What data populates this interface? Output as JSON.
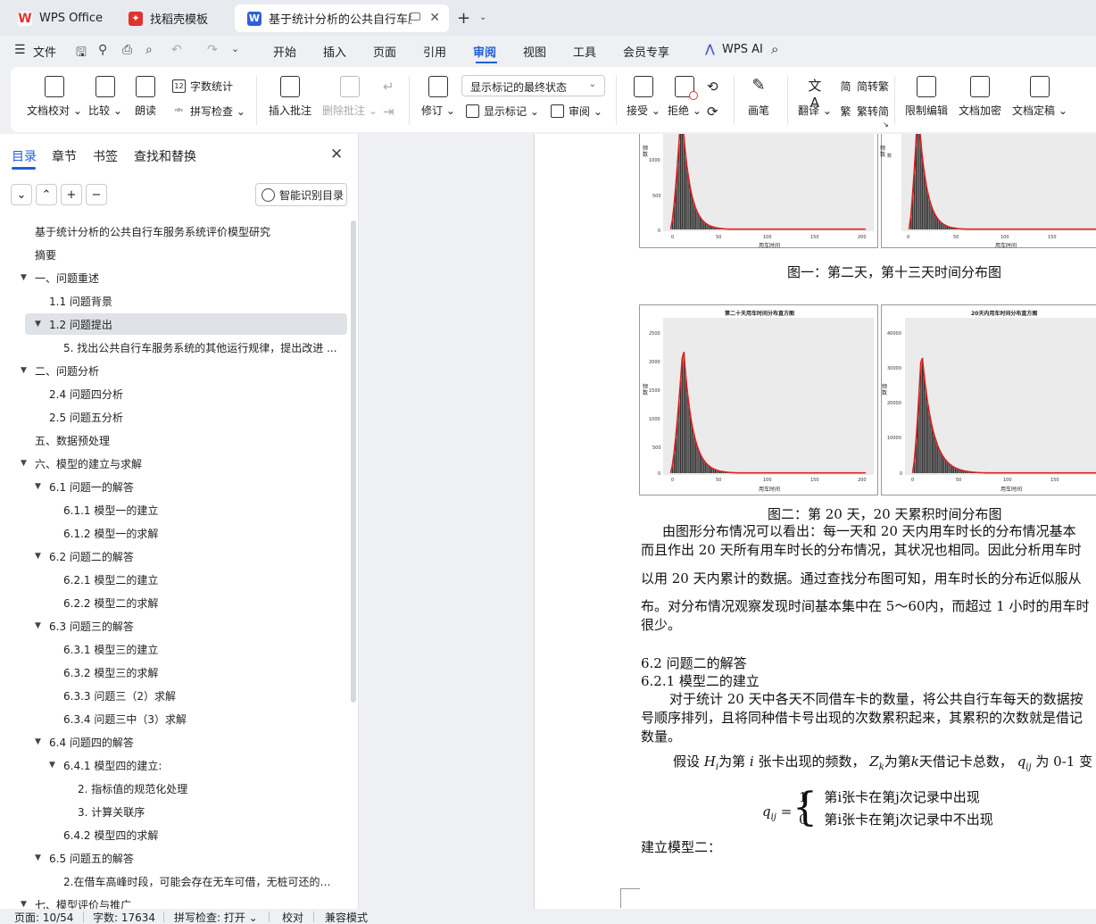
{
  "tabs": [
    {
      "label": "WPS Office",
      "icon": "wps-logo-icon"
    },
    {
      "label": "找稻壳模板",
      "icon": "docer-logo-icon"
    },
    {
      "label": "基于统计分析的公共自行车服务",
      "icon": "word-doc-icon"
    }
  ],
  "menu": {
    "file": "文件",
    "items": [
      "开始",
      "插入",
      "页面",
      "引用",
      "审阅",
      "视图",
      "工具",
      "会员专享"
    ],
    "active": "审阅",
    "wps_ai": "WPS AI"
  },
  "ribbon": {
    "doc_proof": "文档校对",
    "compare": "比较",
    "read_aloud": "朗读",
    "word_count": "字数统计",
    "spell_check": "拼写检查",
    "insert_comment": "插入批注",
    "delete_comment": "删除批注",
    "revise": "修订",
    "markup_state": "显示标记的最终状态",
    "show_markup": "显示标记",
    "review_pane": "审阅",
    "accept": "接受",
    "reject": "拒绝",
    "pen": "画笔",
    "translate": "翻译",
    "simp_to_trad": "简转繁",
    "trad_to_simp": "繁转简",
    "restrict_edit": "限制编辑",
    "doc_encrypt": "文档加密",
    "doc_finalize": "文档定稿"
  },
  "sidebar": {
    "tabs": [
      "目录",
      "章节",
      "书签",
      "查找和替换"
    ],
    "smart_toc": "智能识别目录",
    "toc": [
      {
        "text": "基于统计分析的公共自行车服务系统评价模型研究",
        "level": 0,
        "arrow": false
      },
      {
        "text": "摘要",
        "level": 0,
        "arrow": false
      },
      {
        "text": "一、问题重述",
        "level": 0,
        "arrow": true
      },
      {
        "text": "1.1 问题背景",
        "level": 1,
        "arrow": false
      },
      {
        "text": "1.2 问题提出",
        "level": 1,
        "arrow": true,
        "selected": true
      },
      {
        "text": "5. 找出公共自行车服务系统的其他运行规律，提出改进 ...",
        "level": 2,
        "arrow": false
      },
      {
        "text": "二、问题分析",
        "level": 0,
        "arrow": true
      },
      {
        "text": "2.4 问题四分析",
        "level": 1,
        "arrow": false
      },
      {
        "text": "2.5 问题五分析",
        "level": 1,
        "arrow": false
      },
      {
        "text": "五、数据预处理",
        "level": 0,
        "arrow": false
      },
      {
        "text": "六、模型的建立与求解",
        "level": 0,
        "arrow": true
      },
      {
        "text": "6.1 问题一的解答",
        "level": 1,
        "arrow": true
      },
      {
        "text": "6.1.1 模型一的建立",
        "level": 2,
        "arrow": false
      },
      {
        "text": "6.1.2 模型一的求解",
        "level": 2,
        "arrow": false
      },
      {
        "text": "6.2 问题二的解答",
        "level": 1,
        "arrow": true
      },
      {
        "text": "6.2.1 模型二的建立",
        "level": 2,
        "arrow": false
      },
      {
        "text": "6.2.2 模型二的求解",
        "level": 2,
        "arrow": false
      },
      {
        "text": "6.3 问题三的解答",
        "level": 1,
        "arrow": true
      },
      {
        "text": "6.3.1 模型三的建立",
        "level": 2,
        "arrow": false
      },
      {
        "text": "6.3.2 模型三的求解",
        "level": 2,
        "arrow": false
      },
      {
        "text": "6.3.3  问题三（2）求解",
        "level": 2,
        "arrow": false
      },
      {
        "text": "6.3.4  问题三中（3）求解",
        "level": 2,
        "arrow": false
      },
      {
        "text": "6.4 问题四的解答",
        "level": 1,
        "arrow": true
      },
      {
        "text": "6.4.1 模型四的建立:",
        "level": 2,
        "arrow": true
      },
      {
        "text": "2. 指标值的规范化处理",
        "level": 3,
        "arrow": false
      },
      {
        "text": "3. 计算关联序",
        "level": 3,
        "arrow": false
      },
      {
        "text": "6.4.2 模型四的求解",
        "level": 2,
        "arrow": false
      },
      {
        "text": "6.5 问题五的解答",
        "level": 1,
        "arrow": true
      },
      {
        "text": "2.在借车高峰时段，可能会存在无车可借，无桩可还的情...",
        "level": 2,
        "arrow": false
      },
      {
        "text": "七、模型评价与推广",
        "level": 0,
        "arrow": true
      }
    ]
  },
  "document": {
    "fig1_caption": "图一：第二天，第十三天时间分布图",
    "fig2_caption": "图二：第 20 天，20 天累积时间分布图",
    "fig_top": {
      "ylabel": "频数",
      "xlabel": "用车时间",
      "yticks_left": [
        "1000",
        "500",
        "0"
      ],
      "yticks_right": [
        "数"
      ],
      "xticks_left": [
        "0",
        "50",
        "100",
        "150",
        "200"
      ],
      "xticks_right": [
        "0",
        "50",
        "100",
        "150"
      ]
    },
    "fig_bottom_left": {
      "title": "第二十天用车时间分布直方图",
      "ylabel": "频数",
      "xlabel": "用车时间",
      "yticks": [
        "2500",
        "2000",
        "1500",
        "1000",
        "500",
        "0"
      ],
      "xticks": [
        "0",
        "50",
        "100",
        "150",
        "200"
      ]
    },
    "fig_bottom_right": {
      "title": "20天内用车时间分布直方图",
      "ylabel": "频数",
      "xlabel": "用车时间",
      "yticks": [
        "40000",
        "30000",
        "20000",
        "10000",
        "0"
      ],
      "xticks": [
        "0",
        "50",
        "100",
        "150"
      ]
    },
    "para1": [
      "由图形分布情况可以看出：每一天和 20 天内用车时长的分布情况基本",
      "而且作出 20 天所有用车时长的分布情况，其状况也相同。因此分析用车时",
      "以用 20 天内累计的数据。通过查找分布图可知，用车时长的分布近似服从",
      "布。对分布情况观察发现时间基本集中在 5～60内，而超过 1 小时的用车时",
      "很少。"
    ],
    "h_6_2": "6.2 问题二的解答",
    "h_6_2_1": "6.2.1 模型二的建立",
    "para2": [
      "对于统计 20 天中各天不同借车卡的数量，将公共自行车每天的数据按",
      "号顺序排列，且将同种借卡号出现的次数累积起来，其累积的次数就是借记",
      "数量。"
    ],
    "assume": "假设 H_i为第 i 张卡出现的频数， Z_k为第 k 天借记卡总数， q_ij为 0-1 变",
    "assume_parts": [
      "假设",
      "为第",
      "张卡出现的频数，",
      "为第",
      "天借记卡总数，",
      "为 0-1 变"
    ],
    "eq_lhs": "q_ij =",
    "eq_case1_val": "1",
    "eq_case1_text": "第i张卡在第j次记录中出现",
    "eq_case2_val": "0",
    "eq_case2_text": "第i张卡在第j次记录中不出现",
    "model2": "建立模型二："
  },
  "status": {
    "page": "页面: 10/54",
    "words": "字数: 17634",
    "spell": "拼写检查: 打开",
    "proof": "校对",
    "compat": "兼容模式"
  },
  "colors": {
    "accent": "#1f5fd6",
    "wps_red": "#e0332d",
    "curve_red": "#e02020"
  }
}
